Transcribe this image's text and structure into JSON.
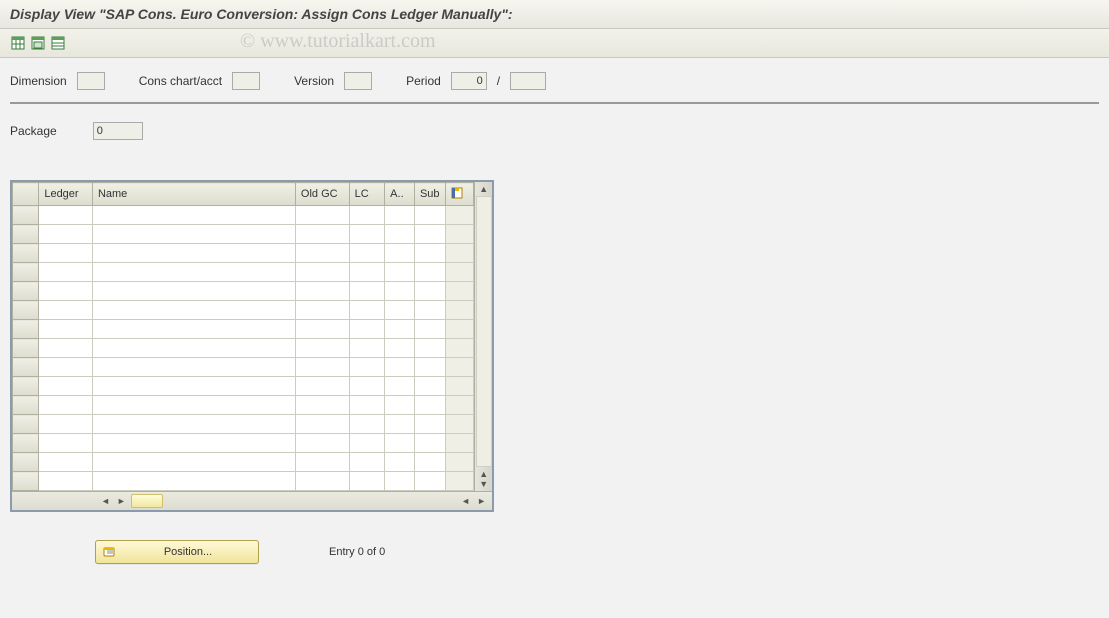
{
  "title": "Display View \"SAP Cons. Euro Conversion: Assign Cons Ledger Manually\":",
  "watermark": "© www.tutorialkart.com",
  "header": {
    "dimension_label": "Dimension",
    "dimension_value": "",
    "cons_chart_label": "Cons chart/acct",
    "cons_chart_value": "",
    "version_label": "Version",
    "version_value": "",
    "period_label": "Period",
    "period_value": "0",
    "period_sep": "/",
    "period_year_value": ""
  },
  "package": {
    "label": "Package",
    "value": "0"
  },
  "table": {
    "columns": [
      "Ledger",
      "Name",
      "Old GC",
      "LC",
      "A..",
      "Sub"
    ],
    "row_count": 15
  },
  "footer": {
    "position_label": "Position...",
    "entry_text": "Entry 0 of 0"
  }
}
